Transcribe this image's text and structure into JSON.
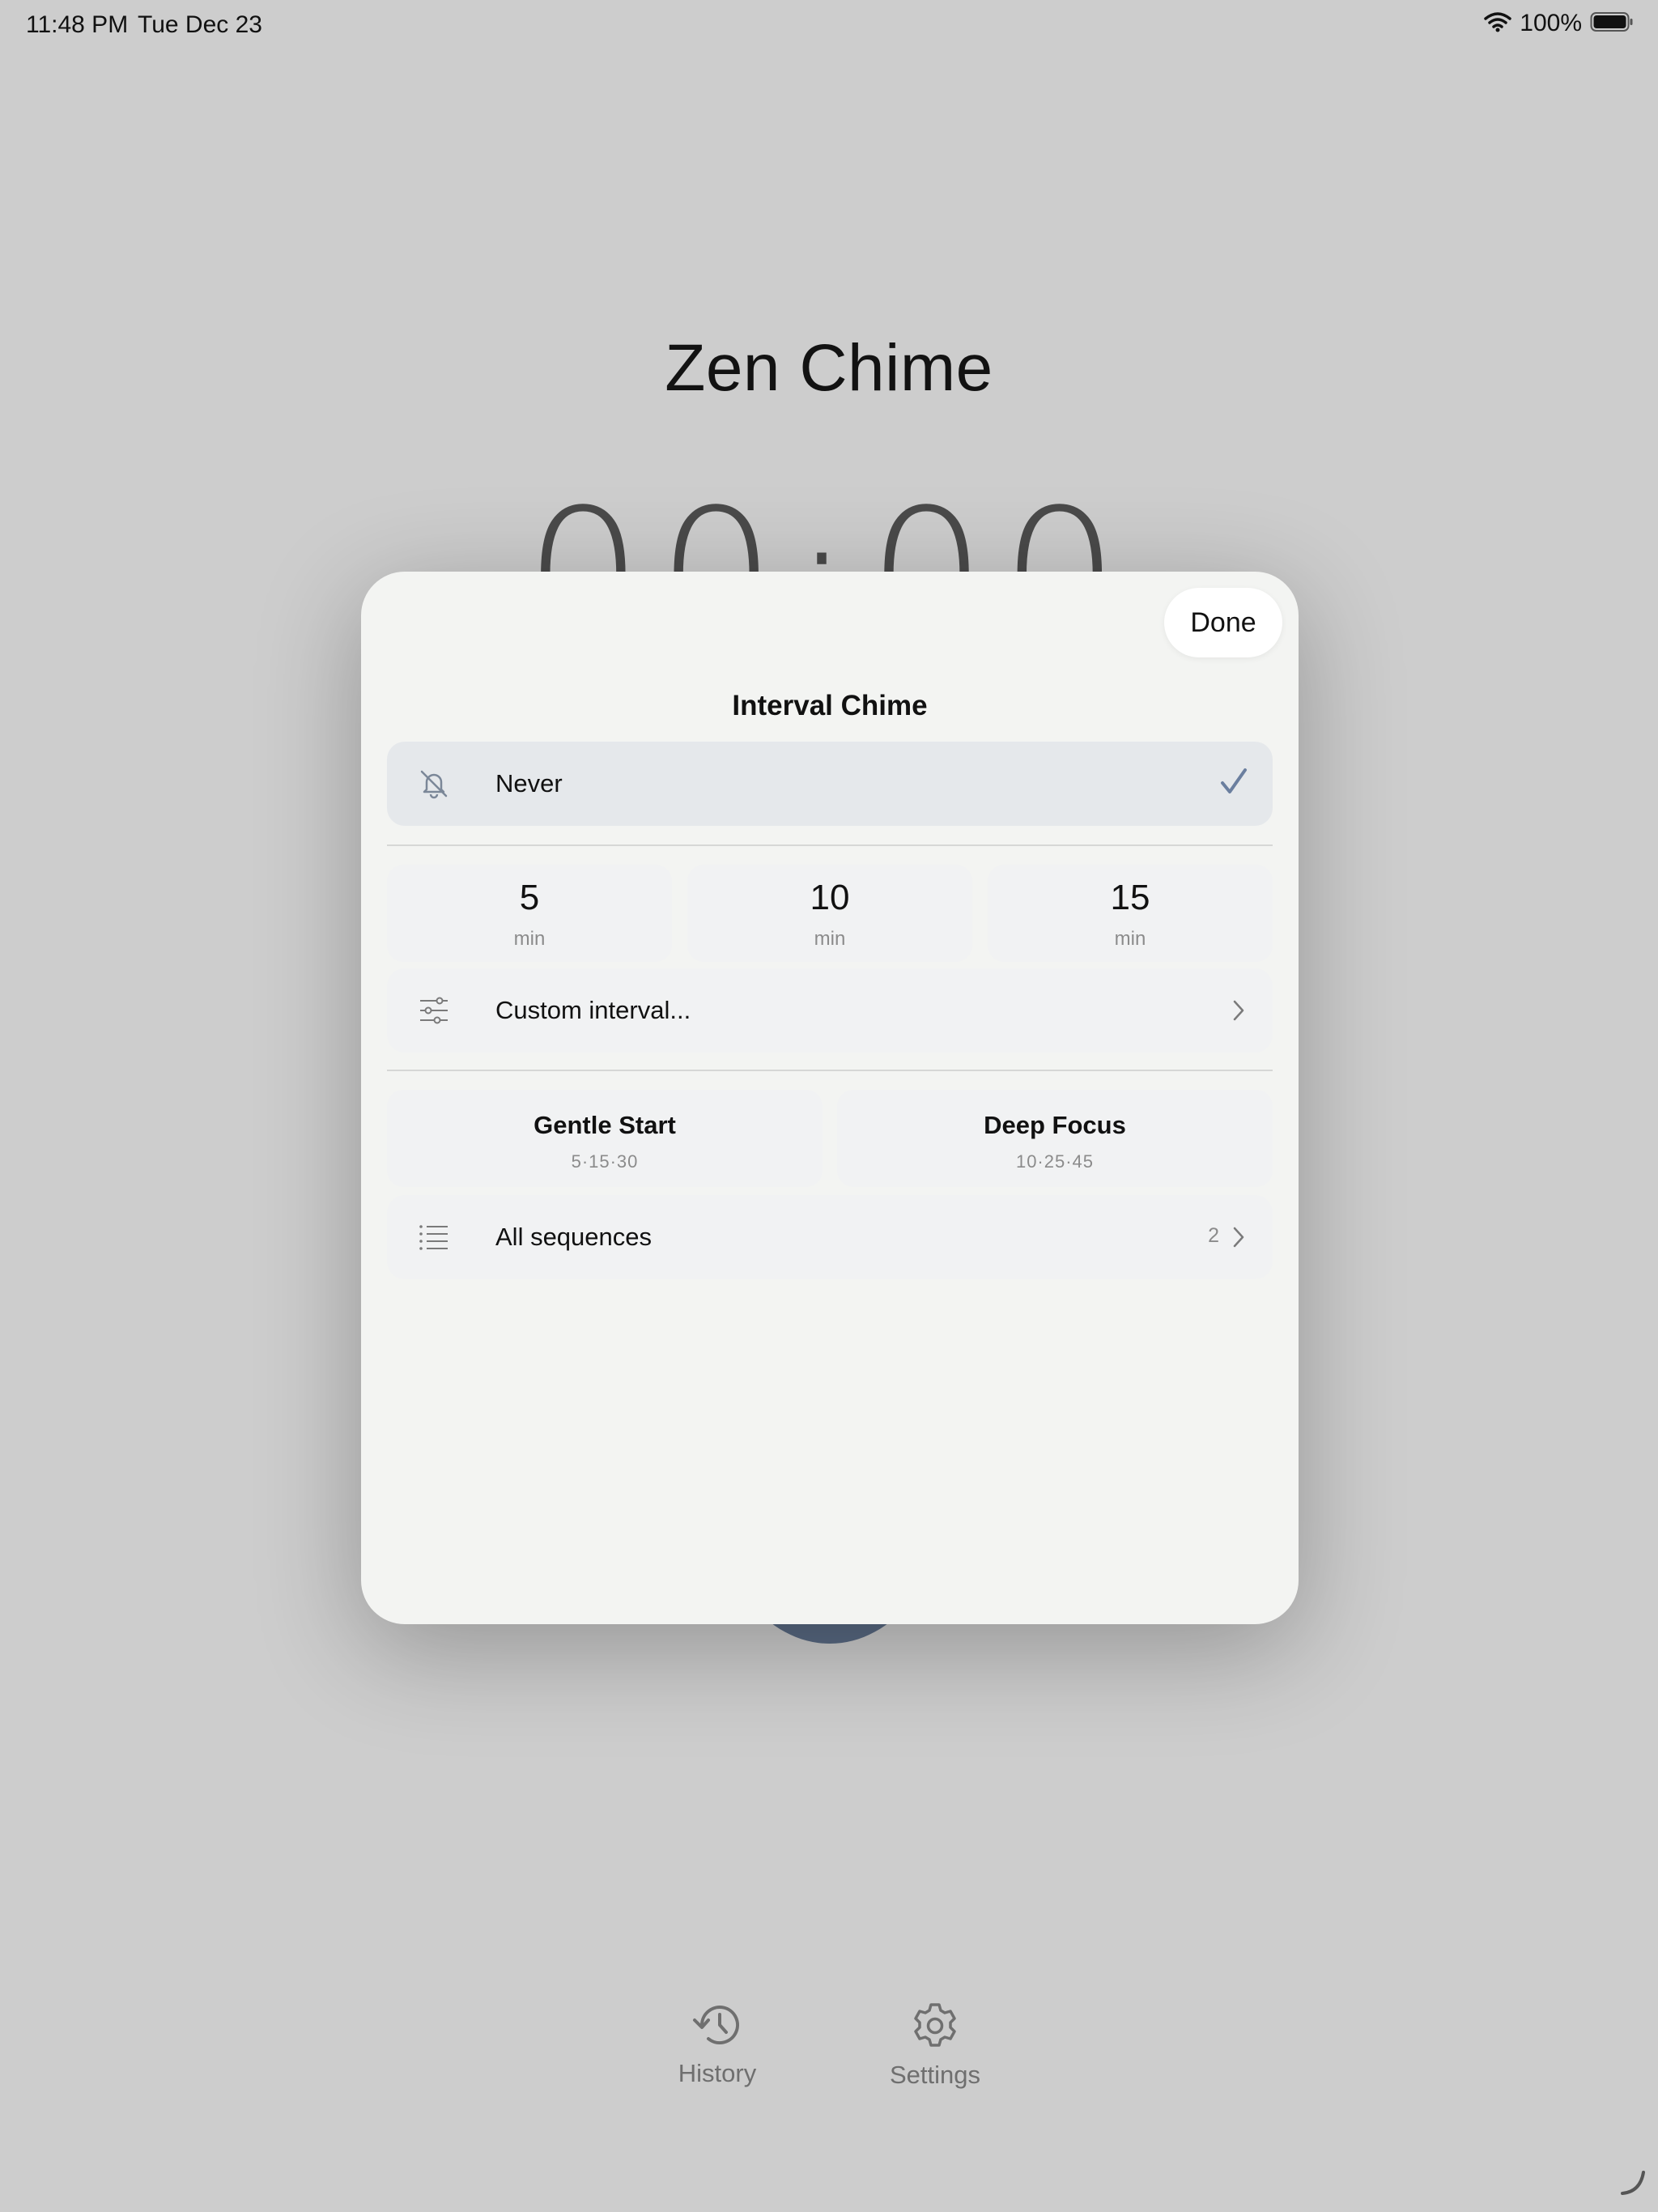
{
  "status_bar": {
    "time": "11:48 PM",
    "date": "Tue Dec 23",
    "battery": "100%"
  },
  "app": {
    "title": "Zen Chime",
    "timer": "00:00",
    "accent_color": "#596a83"
  },
  "tabs": [
    {
      "label": "History",
      "icon": "history-icon"
    },
    {
      "label": "Settings",
      "icon": "gear-icon"
    }
  ],
  "sheet": {
    "done_label": "Done",
    "title": "Interval Chime",
    "never": {
      "label": "Never",
      "icon": "bell-slash-icon",
      "selected": true
    },
    "intervals": [
      {
        "value": "5",
        "unit": "min"
      },
      {
        "value": "10",
        "unit": "min"
      },
      {
        "value": "15",
        "unit": "min"
      }
    ],
    "custom": {
      "label": "Custom interval...",
      "icon": "sliders-icon"
    },
    "sequences": [
      {
        "name": "Gentle Start",
        "pattern": "5·15·30"
      },
      {
        "name": "Deep Focus",
        "pattern": "10·25·45"
      }
    ],
    "all_sequences": {
      "label": "All sequences",
      "count": "2",
      "icon": "list-icon"
    }
  }
}
